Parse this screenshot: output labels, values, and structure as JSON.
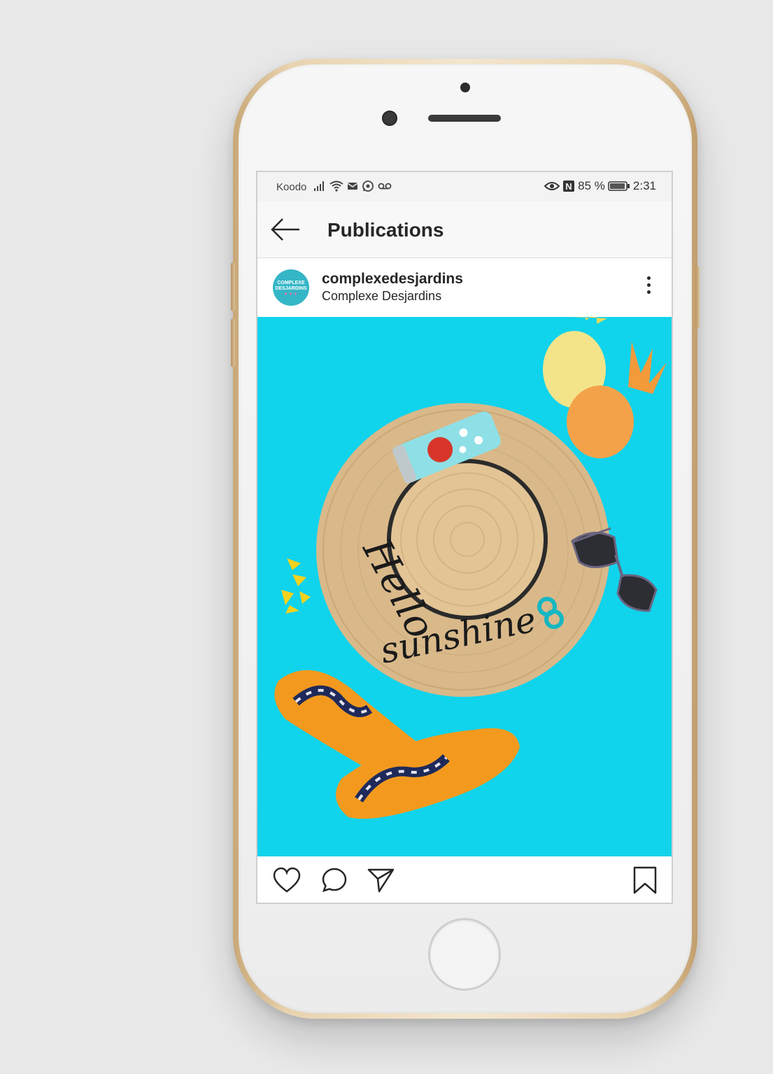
{
  "statusbar": {
    "carrier": "Koodo",
    "battery_percent": "85 %",
    "time": "2:31",
    "icons": [
      "signal-icon",
      "wifi-icon",
      "mail-icon",
      "whatsapp-icon",
      "voicemail-icon",
      "eye-icon",
      "nfc-icon",
      "battery-icon"
    ]
  },
  "appbar": {
    "back_icon": "arrow-left-icon",
    "title": "Publications"
  },
  "post": {
    "username": "complexedesjardins",
    "location": "Complexe Desjardins",
    "avatar_text": "COMPLEXE DESJARDINS",
    "more_icon": "more-vertical-icon",
    "image": {
      "description_icon": "post-photo",
      "embroidered_text": "Hello sunshine"
    }
  },
  "actions": {
    "like_icon": "heart-icon",
    "comment_icon": "comment-icon",
    "share_icon": "send-icon",
    "save_icon": "bookmark-icon"
  },
  "colors": {
    "photo_background": "#10d3ec",
    "hat": "#d9b98a",
    "sandal": "#f39a1e",
    "pineapple_yellow": "#f3e48a",
    "pineapple_orange": "#f4a24a",
    "phone_gold": "#e8d3b0"
  }
}
